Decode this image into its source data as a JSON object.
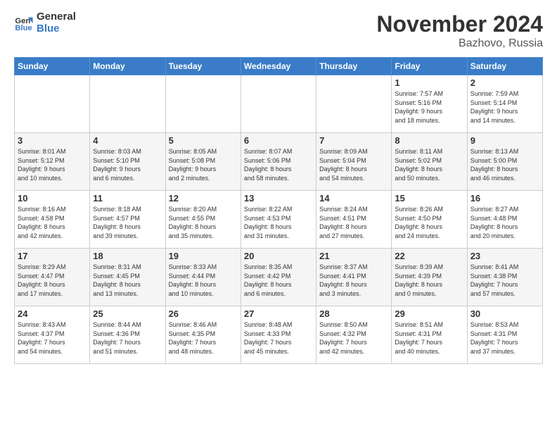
{
  "logo": {
    "line1": "General",
    "line2": "Blue"
  },
  "title": "November 2024",
  "location": "Bazhovo, Russia",
  "days_of_week": [
    "Sunday",
    "Monday",
    "Tuesday",
    "Wednesday",
    "Thursday",
    "Friday",
    "Saturday"
  ],
  "weeks": [
    [
      {
        "day": "",
        "info": ""
      },
      {
        "day": "",
        "info": ""
      },
      {
        "day": "",
        "info": ""
      },
      {
        "day": "",
        "info": ""
      },
      {
        "day": "",
        "info": ""
      },
      {
        "day": "1",
        "info": "Sunrise: 7:57 AM\nSunset: 5:16 PM\nDaylight: 9 hours\nand 18 minutes."
      },
      {
        "day": "2",
        "info": "Sunrise: 7:59 AM\nSunset: 5:14 PM\nDaylight: 9 hours\nand 14 minutes."
      }
    ],
    [
      {
        "day": "3",
        "info": "Sunrise: 8:01 AM\nSunset: 5:12 PM\nDaylight: 9 hours\nand 10 minutes."
      },
      {
        "day": "4",
        "info": "Sunrise: 8:03 AM\nSunset: 5:10 PM\nDaylight: 9 hours\nand 6 minutes."
      },
      {
        "day": "5",
        "info": "Sunrise: 8:05 AM\nSunset: 5:08 PM\nDaylight: 9 hours\nand 2 minutes."
      },
      {
        "day": "6",
        "info": "Sunrise: 8:07 AM\nSunset: 5:06 PM\nDaylight: 8 hours\nand 58 minutes."
      },
      {
        "day": "7",
        "info": "Sunrise: 8:09 AM\nSunset: 5:04 PM\nDaylight: 8 hours\nand 54 minutes."
      },
      {
        "day": "8",
        "info": "Sunrise: 8:11 AM\nSunset: 5:02 PM\nDaylight: 8 hours\nand 50 minutes."
      },
      {
        "day": "9",
        "info": "Sunrise: 8:13 AM\nSunset: 5:00 PM\nDaylight: 8 hours\nand 46 minutes."
      }
    ],
    [
      {
        "day": "10",
        "info": "Sunrise: 8:16 AM\nSunset: 4:58 PM\nDaylight: 8 hours\nand 42 minutes."
      },
      {
        "day": "11",
        "info": "Sunrise: 8:18 AM\nSunset: 4:57 PM\nDaylight: 8 hours\nand 39 minutes."
      },
      {
        "day": "12",
        "info": "Sunrise: 8:20 AM\nSunset: 4:55 PM\nDaylight: 8 hours\nand 35 minutes."
      },
      {
        "day": "13",
        "info": "Sunrise: 8:22 AM\nSunset: 4:53 PM\nDaylight: 8 hours\nand 31 minutes."
      },
      {
        "day": "14",
        "info": "Sunrise: 8:24 AM\nSunset: 4:51 PM\nDaylight: 8 hours\nand 27 minutes."
      },
      {
        "day": "15",
        "info": "Sunrise: 8:26 AM\nSunset: 4:50 PM\nDaylight: 8 hours\nand 24 minutes."
      },
      {
        "day": "16",
        "info": "Sunrise: 8:27 AM\nSunset: 4:48 PM\nDaylight: 8 hours\nand 20 minutes."
      }
    ],
    [
      {
        "day": "17",
        "info": "Sunrise: 8:29 AM\nSunset: 4:47 PM\nDaylight: 8 hours\nand 17 minutes."
      },
      {
        "day": "18",
        "info": "Sunrise: 8:31 AM\nSunset: 4:45 PM\nDaylight: 8 hours\nand 13 minutes."
      },
      {
        "day": "19",
        "info": "Sunrise: 8:33 AM\nSunset: 4:44 PM\nDaylight: 8 hours\nand 10 minutes."
      },
      {
        "day": "20",
        "info": "Sunrise: 8:35 AM\nSunset: 4:42 PM\nDaylight: 8 hours\nand 6 minutes."
      },
      {
        "day": "21",
        "info": "Sunrise: 8:37 AM\nSunset: 4:41 PM\nDaylight: 8 hours\nand 3 minutes."
      },
      {
        "day": "22",
        "info": "Sunrise: 8:39 AM\nSunset: 4:39 PM\nDaylight: 8 hours\nand 0 minutes."
      },
      {
        "day": "23",
        "info": "Sunrise: 8:41 AM\nSunset: 4:38 PM\nDaylight: 7 hours\nand 57 minutes."
      }
    ],
    [
      {
        "day": "24",
        "info": "Sunrise: 8:43 AM\nSunset: 4:37 PM\nDaylight: 7 hours\nand 54 minutes."
      },
      {
        "day": "25",
        "info": "Sunrise: 8:44 AM\nSunset: 4:36 PM\nDaylight: 7 hours\nand 51 minutes."
      },
      {
        "day": "26",
        "info": "Sunrise: 8:46 AM\nSunset: 4:35 PM\nDaylight: 7 hours\nand 48 minutes."
      },
      {
        "day": "27",
        "info": "Sunrise: 8:48 AM\nSunset: 4:33 PM\nDaylight: 7 hours\nand 45 minutes."
      },
      {
        "day": "28",
        "info": "Sunrise: 8:50 AM\nSunset: 4:32 PM\nDaylight: 7 hours\nand 42 minutes."
      },
      {
        "day": "29",
        "info": "Sunrise: 8:51 AM\nSunset: 4:31 PM\nDaylight: 7 hours\nand 40 minutes."
      },
      {
        "day": "30",
        "info": "Sunrise: 8:53 AM\nSunset: 4:31 PM\nDaylight: 7 hours\nand 37 minutes."
      }
    ]
  ]
}
